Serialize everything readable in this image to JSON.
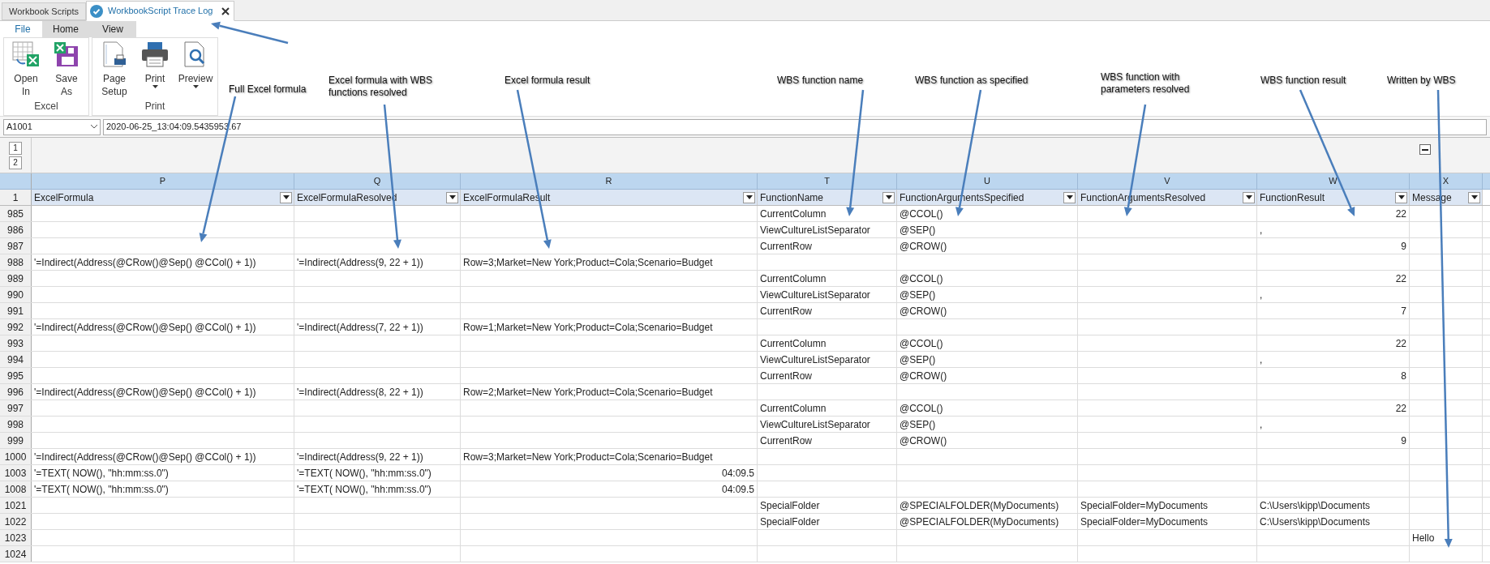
{
  "doc_tabs": [
    {
      "label": "Workbook Scripts",
      "selected": false,
      "closable": false
    },
    {
      "label": "WorkbookScript Trace Log",
      "selected": true,
      "closable": true
    }
  ],
  "ribbon_tabs": [
    {
      "label": "File",
      "selected": true
    },
    {
      "label": "Home",
      "selected": false
    },
    {
      "label": "View",
      "selected": false
    }
  ],
  "ribbon_groups": [
    {
      "label": "Excel",
      "buttons": [
        {
          "kind": "open",
          "lines": [
            "Open",
            "In"
          ],
          "dropdown": false
        },
        {
          "kind": "save",
          "lines": [
            "Save",
            "As"
          ],
          "dropdown": false
        }
      ]
    },
    {
      "label": "Print",
      "buttons": [
        {
          "kind": "page",
          "lines": [
            "Page",
            "Setup"
          ],
          "dropdown": false
        },
        {
          "kind": "print",
          "lines": [
            "Print"
          ],
          "dropdown": true
        },
        {
          "kind": "preview",
          "lines": [
            "Preview"
          ],
          "dropdown": true
        }
      ]
    }
  ],
  "name_box": "A1001",
  "formula": "2020-06-25_13:04:09.5435953.67",
  "outline_levels": [
    "1",
    "2"
  ],
  "columns": [
    {
      "letter": "P",
      "header": "ExcelFormula"
    },
    {
      "letter": "Q",
      "header": "ExcelFormulaResolved"
    },
    {
      "letter": "R",
      "header": "ExcelFormulaResult"
    },
    {
      "letter": "T",
      "header": "FunctionName"
    },
    {
      "letter": "U",
      "header": "FunctionArgumentsSpecified"
    },
    {
      "letter": "V",
      "header": "FunctionArgumentsResolved"
    },
    {
      "letter": "W",
      "header": "FunctionResult"
    },
    {
      "letter": "X",
      "header": "Message"
    }
  ],
  "header_row": "1",
  "rows": [
    {
      "num": "985",
      "cells": [
        "",
        "",
        "",
        "CurrentColumn",
        "@CCOL()",
        "",
        {
          "text": "22",
          "right_aligned": true
        },
        ""
      ]
    },
    {
      "num": "986",
      "cells": [
        "",
        "",
        "",
        "ViewCultureListSeparator",
        "@SEP()",
        "",
        ",",
        ""
      ]
    },
    {
      "num": "987",
      "cells": [
        "",
        "",
        "",
        "CurrentRow",
        "@CROW()",
        "",
        {
          "text": "9",
          "right_aligned": true
        },
        ""
      ]
    },
    {
      "num": "988",
      "cells": [
        "'=Indirect(Address(@CRow()@Sep() @CCol() + 1))",
        "'=Indirect(Address(9, 22 + 1))",
        "Row=3;Market=New York;Product=Cola;Scenario=Budget",
        "",
        "",
        "",
        "",
        ""
      ]
    },
    {
      "num": "989",
      "cells": [
        "",
        "",
        "",
        "CurrentColumn",
        "@CCOL()",
        "",
        {
          "text": "22",
          "right_aligned": true
        },
        ""
      ]
    },
    {
      "num": "990",
      "cells": [
        "",
        "",
        "",
        "ViewCultureListSeparator",
        "@SEP()",
        "",
        ",",
        ""
      ]
    },
    {
      "num": "991",
      "cells": [
        "",
        "",
        "",
        "CurrentRow",
        "@CROW()",
        "",
        {
          "text": "7",
          "right_aligned": true
        },
        ""
      ]
    },
    {
      "num": "992",
      "cells": [
        "'=Indirect(Address(@CRow()@Sep() @CCol() + 1))",
        "'=Indirect(Address(7, 22 + 1))",
        "Row=1;Market=New York;Product=Cola;Scenario=Budget",
        "",
        "",
        "",
        "",
        ""
      ]
    },
    {
      "num": "993",
      "cells": [
        "",
        "",
        "",
        "CurrentColumn",
        "@CCOL()",
        "",
        {
          "text": "22",
          "right_aligned": true
        },
        ""
      ]
    },
    {
      "num": "994",
      "cells": [
        "",
        "",
        "",
        "ViewCultureListSeparator",
        "@SEP()",
        "",
        ",",
        ""
      ]
    },
    {
      "num": "995",
      "cells": [
        "",
        "",
        "",
        "CurrentRow",
        "@CROW()",
        "",
        {
          "text": "8",
          "right_aligned": true
        },
        ""
      ]
    },
    {
      "num": "996",
      "cells": [
        "'=Indirect(Address(@CRow()@Sep() @CCol() + 1))",
        "'=Indirect(Address(8, 22 + 1))",
        "Row=2;Market=New York;Product=Cola;Scenario=Budget",
        "",
        "",
        "",
        "",
        ""
      ]
    },
    {
      "num": "997",
      "cells": [
        "",
        "",
        "",
        "CurrentColumn",
        "@CCOL()",
        "",
        {
          "text": "22",
          "right_aligned": true
        },
        ""
      ]
    },
    {
      "num": "998",
      "cells": [
        "",
        "",
        "",
        "ViewCultureListSeparator",
        "@SEP()",
        "",
        ",",
        ""
      ]
    },
    {
      "num": "999",
      "cells": [
        "",
        "",
        "",
        "CurrentRow",
        "@CROW()",
        "",
        {
          "text": "9",
          "right_aligned": true
        },
        ""
      ]
    },
    {
      "num": "1000",
      "cells": [
        "'=Indirect(Address(@CRow()@Sep() @CCol() + 1))",
        "'=Indirect(Address(9, 22 + 1))",
        "Row=3;Market=New York;Product=Cola;Scenario=Budget",
        "",
        "",
        "",
        "",
        ""
      ]
    },
    {
      "num": "1003",
      "cells": [
        "'=TEXT( NOW(), \"hh:mm:ss.0\")",
        "'=TEXT( NOW(), \"hh:mm:ss.0\")",
        {
          "text": "04:09.5",
          "right_aligned": true
        },
        "",
        "",
        "",
        "",
        ""
      ]
    },
    {
      "num": "1008",
      "cells": [
        "'=TEXT( NOW(), \"hh:mm:ss.0\")",
        "'=TEXT( NOW(), \"hh:mm:ss.0\")",
        {
          "text": "04:09.5",
          "right_aligned": true
        },
        "",
        "",
        "",
        "",
        ""
      ]
    },
    {
      "num": "1021",
      "cells": [
        "",
        "",
        "",
        "SpecialFolder",
        "@SPECIALFOLDER(MyDocuments)",
        "SpecialFolder=MyDocuments",
        "C:\\Users\\kipp\\Documents",
        ""
      ]
    },
    {
      "num": "1022",
      "cells": [
        "",
        "",
        "",
        "SpecialFolder",
        "@SPECIALFOLDER(MyDocuments)",
        "SpecialFolder=MyDocuments",
        "C:\\Users\\kipp\\Documents",
        ""
      ]
    },
    {
      "num": "1023",
      "cells": [
        "",
        "",
        "",
        "",
        "",
        "",
        "",
        "Hello"
      ]
    },
    {
      "num": "1024",
      "cells": [
        "",
        "",
        "",
        "",
        "",
        "",
        "",
        ""
      ]
    }
  ],
  "annotations": [
    {
      "lines": [
        "Full Excel formula"
      ]
    },
    {
      "lines": [
        "Excel formula with WBS",
        "functions resolved"
      ]
    },
    {
      "lines": [
        "Excel formula result"
      ]
    },
    {
      "lines": [
        "WBS function name"
      ]
    },
    {
      "lines": [
        "WBS function as specified"
      ]
    },
    {
      "lines": [
        "WBS function with",
        "parameters resolved"
      ]
    },
    {
      "lines": [
        "WBS function result"
      ]
    },
    {
      "lines": [
        "Written by WBS"
      ]
    }
  ]
}
